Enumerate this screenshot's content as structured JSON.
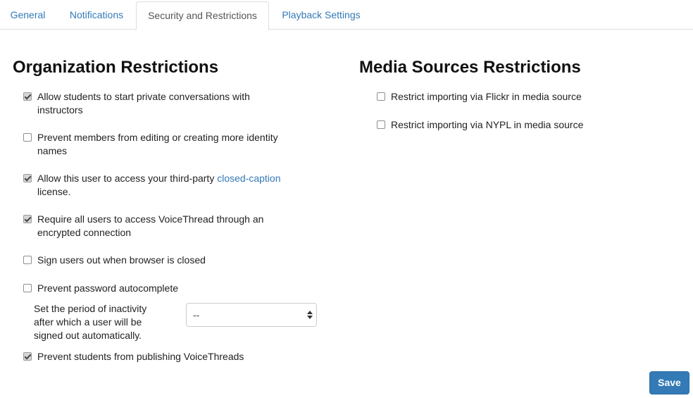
{
  "tabs": [
    {
      "label": "General",
      "active": false
    },
    {
      "label": "Notifications",
      "active": false
    },
    {
      "label": "Security and Restrictions",
      "active": true
    },
    {
      "label": "Playback Settings",
      "active": false
    }
  ],
  "org": {
    "title": "Organization Restrictions",
    "options": [
      {
        "label": "Allow students to start private conversations with instructors",
        "checked": true
      },
      {
        "label": "Prevent members from editing or creating more identity names",
        "checked": false
      },
      {
        "label_before": "Allow this user to access your third-party ",
        "link": "closed-caption",
        "label_after": " license.",
        "checked": true
      },
      {
        "label": "Require all users to access VoiceThread through an encrypted connection",
        "checked": true
      },
      {
        "label": "Sign users out when browser is closed",
        "checked": false
      },
      {
        "label": "Prevent password autocomplete",
        "checked": false
      },
      {
        "label": "Prevent students from publishing VoiceThreads",
        "checked": true
      }
    ],
    "inactivity_label": "Set the period of inactivity after which a user will be signed out automatically.",
    "inactivity_value": "--"
  },
  "media": {
    "title": "Media Sources Restrictions",
    "options": [
      {
        "label": "Restrict importing via Flickr in media source",
        "checked": false
      },
      {
        "label": "Restrict importing via NYPL in media source",
        "checked": false
      }
    ]
  },
  "save_label": "Save",
  "colors": {
    "link": "#337ab7",
    "primary_button": "#337ab7"
  },
  "icons": {
    "select": "up-down-arrows-icon",
    "checkbox": "checkbox-icon"
  }
}
